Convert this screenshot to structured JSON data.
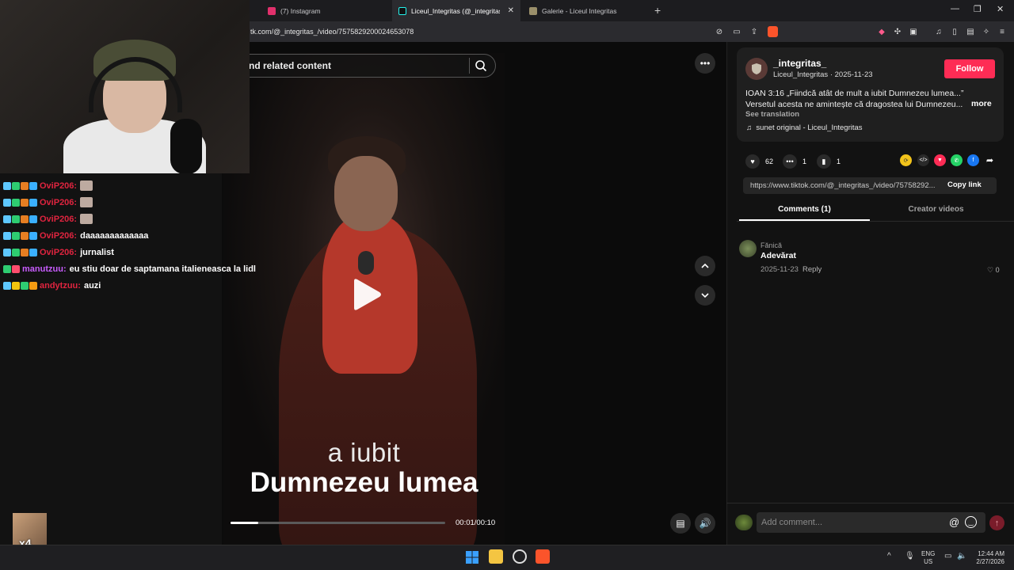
{
  "browser": {
    "tabs": [
      {
        "label": "(7) Instagram",
        "color": "#e1306c"
      },
      {
        "label": "Liceul_Integritas (@_integritas_)",
        "color": "#25f4ee"
      },
      {
        "label": "Galerie - Liceul Integritas",
        "color": "#9a8f6a"
      }
    ],
    "url": "tk.com/@_integritas_/video/7575829200024653078"
  },
  "chat": {
    "messages": [
      {
        "user": "OviP206:",
        "text": "",
        "color": "#e0243f"
      },
      {
        "user": "OviP206:",
        "text": "",
        "color": "#e0243f"
      },
      {
        "user": "OviP206:",
        "text": "",
        "color": "#e0243f"
      },
      {
        "user": "OviP206:",
        "text": "daaaaaaaaaaaaa",
        "color": "#e0243f"
      },
      {
        "user": "OviP206:",
        "text": "jurnalist",
        "color": "#e0243f"
      },
      {
        "user": "manutzuu:",
        "text": "eu stiu doar de saptamana italieneasca la lidl",
        "color": "#c85cff"
      },
      {
        "user": "andytzuu:",
        "text": "auzi",
        "color": "#e0243f"
      }
    ],
    "multiplier": "x4"
  },
  "player": {
    "search_text": "nd related content",
    "caption_line1": "a iubit",
    "caption_line2": "Dumnezeu lumea",
    "time": "00:01/00:10",
    "progress": 0.13
  },
  "post": {
    "handle": "_integritas_",
    "subline": "Liceul_Integritas · 2025-11-23",
    "follow_label": "Follow",
    "desc_line1": "IOAN 3:16 „Fiindcă atât de mult a iubit Dumnezeu lumea...”",
    "desc_line2": "Versetul acesta ne amintește că dragostea lui Dumnezeu...",
    "more_label": "more",
    "see_translation": "See translation",
    "sound": "sunet original - Liceul_Integritas",
    "likes": "62",
    "comments": "1",
    "saves": "1",
    "link": "https://www.tiktok.com/@_integritas_/video/75758292...",
    "copy_link": "Copy link",
    "tab_comments": "Comments (1)",
    "tab_creator": "Creator videos"
  },
  "comment": {
    "name": "Fănică",
    "text": "Adevărat",
    "date": "2025-11-23",
    "reply": "Reply",
    "likes": "0"
  },
  "comment_input": {
    "placeholder": "Add comment..."
  },
  "taskbar": {
    "lang1": "ENG",
    "lang2": "US",
    "time": "12:44 AM",
    "date": "2/27/2026"
  }
}
